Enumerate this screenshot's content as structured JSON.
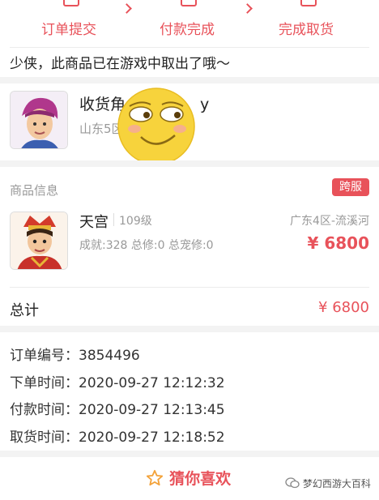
{
  "steps": [
    {
      "label": "订单提交"
    },
    {
      "label": "付款完成"
    },
    {
      "label": "完成取货"
    }
  ],
  "notice": "少侠，此商品已在游戏中取出了哦～",
  "receiver": {
    "title": "收货角",
    "title_tail": "y",
    "server_partial": "山东5区"
  },
  "goods": {
    "section_title": "商品信息",
    "badge": "跨服",
    "name": "天宫",
    "level": "109级",
    "server": "广东4区-流溪河",
    "stats": "成就:328 总修:0 总宠修:0",
    "price": "¥ 6800"
  },
  "total": {
    "label": "总计",
    "value": "¥ 6800"
  },
  "order": {
    "rows": [
      {
        "label": "订单编号：",
        "value": "3854496"
      },
      {
        "label": "下单时间：",
        "value": "2020-09-27 12:12:32"
      },
      {
        "label": "付款时间：",
        "value": "2020-09-27 12:13:45"
      },
      {
        "label": "取货时间：",
        "value": "2020-09-27 12:18:52"
      }
    ]
  },
  "recommend": {
    "title": "猜你喜欢"
  },
  "watermark": "梦幻西游大百科",
  "colors": {
    "accent": "#e8525a",
    "emoji": "#f7d33c"
  }
}
